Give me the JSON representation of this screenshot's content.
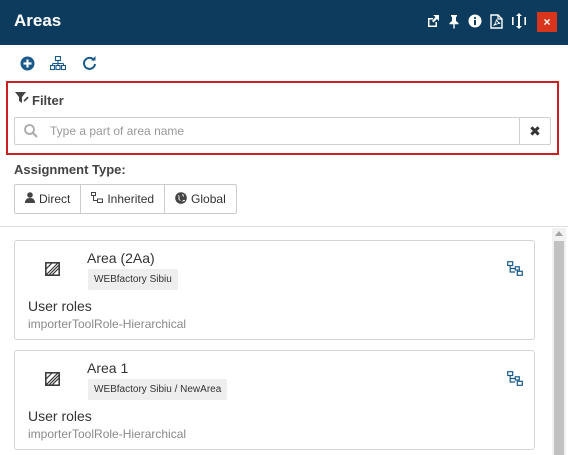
{
  "header": {
    "title": "Areas",
    "icons": [
      "popout-icon",
      "pin-icon",
      "info-icon",
      "pdf-icon",
      "resize-icon"
    ],
    "close_label": "×",
    "background": "#0d3b5e",
    "close_color": "#d9351d"
  },
  "toolbar": {
    "icons": [
      "add-icon",
      "hierarchy-icon",
      "refresh-icon"
    ],
    "icon_color": "#1a5a8a"
  },
  "filter": {
    "label": "Filter",
    "placeholder": "Type a part of area name",
    "value": "",
    "clear_label": "✖",
    "highlight_color": "#cc1f1f"
  },
  "assignment": {
    "label": "Assignment Type:",
    "buttons": [
      {
        "label": "Direct",
        "icon": "user-icon"
      },
      {
        "label": "Inherited",
        "icon": "sitemap-icon"
      },
      {
        "label": "Global",
        "icon": "globe-icon"
      }
    ]
  },
  "cards": [
    {
      "name": "Area (2Aa)",
      "path": "WEBfactory Sibiu",
      "roles_title": "User roles",
      "roles_value": "importerToolRole-Hierarchical"
    },
    {
      "name": "Area 1",
      "path": "WEBfactory Sibiu / NewArea",
      "roles_title": "User roles",
      "roles_value": "importerToolRole-Hierarchical"
    }
  ]
}
